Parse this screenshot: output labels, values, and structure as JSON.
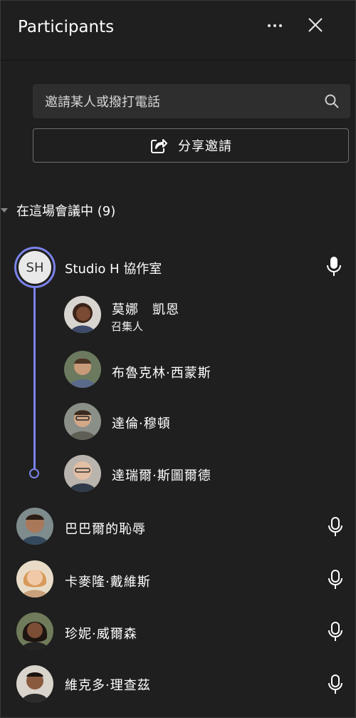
{
  "panel": {
    "title": "Participants",
    "more_icon": "more-icon",
    "close_icon": "close-icon"
  },
  "search": {
    "placeholder": "邀請某人或撥打電話",
    "icon": "search-icon"
  },
  "share": {
    "label": "分享邀請",
    "icon": "share-icon"
  },
  "section": {
    "label": "在這場會議中 (9)"
  },
  "group": {
    "initials": "SH",
    "name": "Studio H 協作室",
    "accent": "#7b83eb",
    "members": [
      {
        "name": "莫娜　凱恩",
        "role": "召集人"
      },
      {
        "name": "布魯克林·西蒙斯"
      },
      {
        "name": "達倫·穆頓"
      },
      {
        "name": "達瑞爾·斯圖爾德"
      }
    ]
  },
  "participants": [
    {
      "name": "巴巴爾的恥辱"
    },
    {
      "name": "卡麥隆·戴維斯"
    },
    {
      "name": "珍妮·威爾森"
    },
    {
      "name": "維克多·理查茲"
    }
  ]
}
